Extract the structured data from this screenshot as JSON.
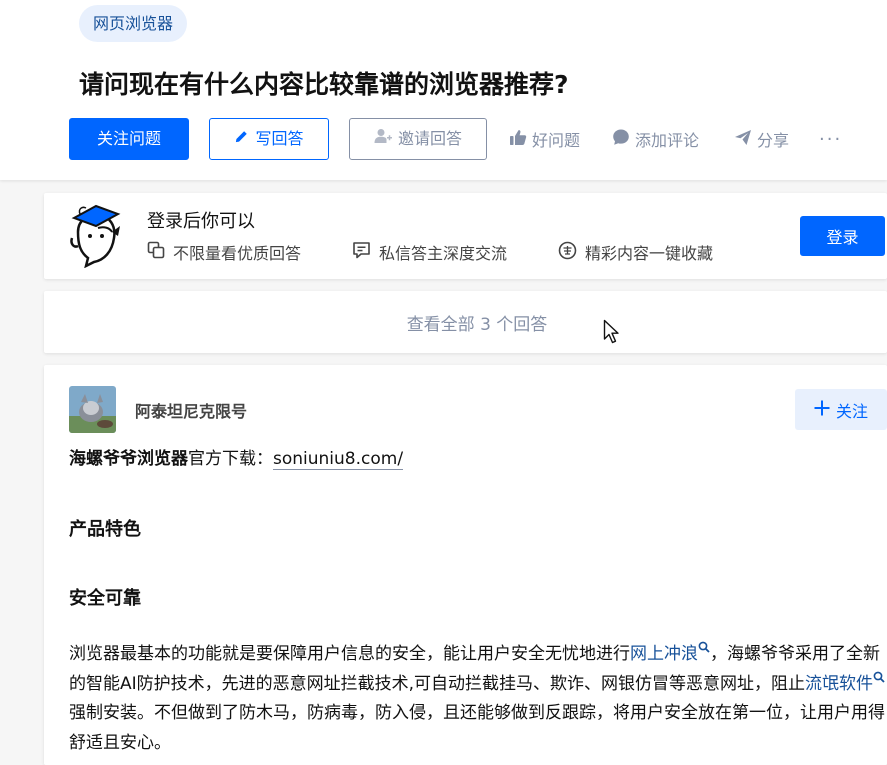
{
  "question": {
    "topic_tag": "网页浏览器",
    "title": "请问现在有什么内容比较靠谱的浏览器推荐?",
    "actions": {
      "follow": "关注问题",
      "write_answer": "写回答",
      "invite": "邀请回答",
      "good_question": "好问题",
      "add_comment": "添加评论",
      "share": "分享",
      "more": "···"
    }
  },
  "login_prompt": {
    "title": "登录后你可以",
    "perks": [
      "不限量看优质回答",
      "私信答主深度交流",
      "精彩内容一键收藏"
    ],
    "login_button": "登录"
  },
  "view_all": "查看全部 3 个回答",
  "answer": {
    "author": "阿泰坦尼克限号",
    "follow_button": "关注",
    "line1_bold": "海螺爷爷浏览器",
    "line1_text": "官方下载：",
    "line1_link": "soniuniu8.com/",
    "heading1": "产品特色",
    "heading2": "安全可靠",
    "para_part1": "浏览器最基本的功能就是要保障用户信息的安全，能让用户安全无忧地进行",
    "para_kw1": "网上冲浪",
    "para_part2": "，海螺爷爷采用了全新的智能AI防护技术，先进的恶意网址拦截技术,可自动拦截挂马、欺诈、网银仿冒等恶意网址，阻止",
    "para_kw2": "流氓软件",
    "para_part3": "强制安装。不但做到了防木马，防病毒，防入侵，且还能够做到反跟踪，将用户安全放在第一位，让用户用得舒适且安心。"
  },
  "colors": {
    "primary": "#0066ff",
    "link": "#175199",
    "muted": "#8590a6",
    "tag_bg": "#e8f0fd"
  }
}
